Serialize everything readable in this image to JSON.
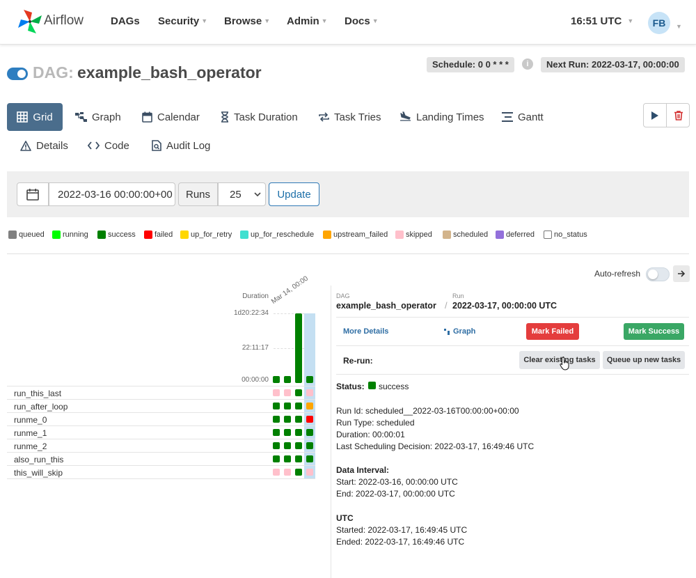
{
  "navbar": {
    "brand": "Airflow",
    "items": [
      {
        "label": "DAGs",
        "dropdown": false
      },
      {
        "label": "Security",
        "dropdown": true
      },
      {
        "label": "Browse",
        "dropdown": true
      },
      {
        "label": "Admin",
        "dropdown": true
      },
      {
        "label": "Docs",
        "dropdown": true
      }
    ],
    "clock": "16:51 UTC",
    "user_initials": "FB"
  },
  "dag": {
    "prefix": "DAG:",
    "name": "example_bash_operator",
    "paused": false,
    "schedule": "Schedule: 0 0 * * *",
    "info_glyph": "i",
    "next_run": "Next Run: 2022-03-17, 00:00:00"
  },
  "tabs": [
    {
      "label": "Grid",
      "icon": "grid-icon",
      "active": true
    },
    {
      "label": "Graph",
      "icon": "graph-icon"
    },
    {
      "label": "Calendar",
      "icon": "calendar-icon"
    },
    {
      "label": "Task Duration",
      "icon": "hourglass-icon"
    },
    {
      "label": "Task Tries",
      "icon": "retry-icon"
    },
    {
      "label": "Landing Times",
      "icon": "plane-landing-icon"
    },
    {
      "label": "Gantt",
      "icon": "gantt-icon"
    },
    {
      "label": "Details",
      "icon": "warning-triangle-icon"
    },
    {
      "label": "Code",
      "icon": "code-icon"
    },
    {
      "label": "Audit Log",
      "icon": "audit-log-icon"
    }
  ],
  "filter": {
    "base_date": "2022-03-16 00:00:00+00",
    "runs_label": "Runs",
    "runs_value": "25",
    "update_label": "Update"
  },
  "legend": [
    {
      "label": "queued",
      "color": "#808080"
    },
    {
      "label": "running",
      "color": "#00ff00"
    },
    {
      "label": "success",
      "color": "#008000"
    },
    {
      "label": "failed",
      "color": "#ff0000"
    },
    {
      "label": "up_for_retry",
      "color": "#ffd700"
    },
    {
      "label": "up_for_reschedule",
      "color": "#40e0d0"
    },
    {
      "label": "upstream_failed",
      "color": "#ffa500"
    },
    {
      "label": "skipped",
      "color": "#ffc0cb"
    },
    {
      "label": "scheduled",
      "color": "#d2b48c"
    },
    {
      "label": "deferred",
      "color": "#9370db"
    },
    {
      "label": "no_status",
      "color": "#ffffff"
    }
  ],
  "auto_refresh": {
    "label": "Auto-refresh",
    "enabled": false
  },
  "grid": {
    "duration_header": "Duration",
    "date_header": "Mar 14, 00:00",
    "duration_ticks": [
      "1d20:22:34",
      "22:11:17",
      "00:00:00"
    ],
    "run_durations": [
      0.08,
      0.08,
      1.0,
      0.08
    ],
    "tasks": [
      {
        "name": "run_this_last",
        "states": [
          "skipped",
          "skipped",
          "success",
          "skipped"
        ]
      },
      {
        "name": "run_after_loop",
        "states": [
          "success",
          "success",
          "success",
          "upstream_failed"
        ]
      },
      {
        "name": "runme_0",
        "states": [
          "success",
          "success",
          "success",
          "failed"
        ]
      },
      {
        "name": "runme_1",
        "states": [
          "success",
          "success",
          "success",
          "success"
        ]
      },
      {
        "name": "runme_2",
        "states": [
          "success",
          "success",
          "success",
          "success"
        ]
      },
      {
        "name": "also_run_this",
        "states": [
          "success",
          "success",
          "success",
          "success"
        ]
      },
      {
        "name": "this_will_skip",
        "states": [
          "skipped",
          "skipped",
          "success",
          "skipped"
        ]
      }
    ]
  },
  "details": {
    "breadcrumb_dag_label": "DAG",
    "breadcrumb_dag": "example_bash_operator",
    "breadcrumb_sep": "/",
    "breadcrumb_run_label": "Run",
    "breadcrumb_run": "2022-03-17, 00:00:00 UTC",
    "more_details": "More Details",
    "graph": "Graph",
    "mark_failed": "Mark Failed",
    "mark_success": "Mark Success",
    "rerun_label": "Re-run:",
    "clear_tasks": "Clear existing tasks",
    "queue_tasks": "Queue up new tasks",
    "status_label": "Status:",
    "status_value": "success",
    "run_id": "Run Id: scheduled__2022-03-16T00:00:00+00:00",
    "run_type": "Run Type: scheduled",
    "duration": "Duration: 00:00:01",
    "last_scheduling": "Last Scheduling Decision: 2022-03-17, 16:49:46 UTC",
    "data_interval_title": "Data Interval:",
    "interval_start": "Start: 2022-03-16, 00:00:00 UTC",
    "interval_end": "End: 2022-03-17, 00:00:00 UTC",
    "utc_title": "UTC",
    "started": "Started: 2022-03-17, 16:49:45 UTC",
    "ended": "Ended: 2022-03-17, 16:49:46 UTC"
  },
  "colors": {
    "accent": "#4a6d8c",
    "mark_failed": "#e43d3d",
    "mark_success": "#3aa765",
    "success": "#008000",
    "skipped": "#ffc0cb",
    "failed": "#ff0000",
    "upstream_failed": "#ffa500",
    "run_highlight": "#c4dff2"
  }
}
